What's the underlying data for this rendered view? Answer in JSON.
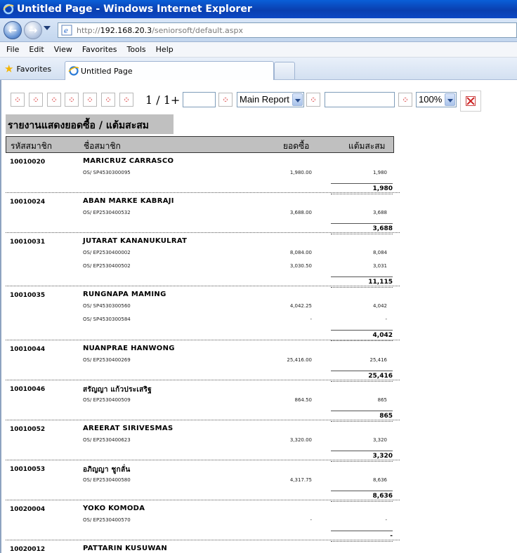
{
  "window": {
    "title": "Untitled Page - Windows Internet Explorer"
  },
  "address": {
    "scheme": "http://",
    "host": "192.168.20.3",
    "path": "/seniorsoft/default.aspx"
  },
  "menu": [
    "File",
    "Edit",
    "View",
    "Favorites",
    "Tools",
    "Help"
  ],
  "favorites_label": "Favorites",
  "tab": {
    "title": "Untitled Page"
  },
  "report_toolbar": {
    "page_indicator": "1 / 1+",
    "report_select": "Main Report",
    "zoom_select": "100%"
  },
  "report": {
    "title": "รายงานแสดงยอดซื้อ / แต้มสะสม",
    "columns": [
      "รหัสสมาชิก",
      "ชื่อสมาชิก",
      "ยอดซื้อ",
      "แต้มสะสม"
    ],
    "groups": [
      {
        "member_id": "10010020",
        "name": "MARICRUZ  CARRASCO",
        "lines": [
          {
            "doc": "OS/ SP4530300095",
            "amount": "1,980.00",
            "points": "1,980"
          }
        ],
        "total": "1,980"
      },
      {
        "member_id": "10010024",
        "name": "ABAN MARKE  KABRAJI",
        "lines": [
          {
            "doc": "OS/ EP2530400532",
            "amount": "3,688.00",
            "points": "3,688"
          }
        ],
        "total": "3,688"
      },
      {
        "member_id": "10010031",
        "name": "JUTARAT  KANANUKULRAT",
        "lines": [
          {
            "doc": "OS/ EP2530400002",
            "amount": "8,084.00",
            "points": "8,084"
          },
          {
            "doc": "OS/ EP2530400502",
            "amount": "3,030.50",
            "points": "3,031"
          }
        ],
        "total": "11,115"
      },
      {
        "member_id": "10010035",
        "name": "RUNGNAPA  MAMING",
        "lines": [
          {
            "doc": "OS/ SP4530300560",
            "amount": "4,042.25",
            "points": "4,042"
          },
          {
            "doc": "OS/ SP4530300584",
            "amount": "-",
            "points": "-"
          }
        ],
        "total": "4,042"
      },
      {
        "member_id": "10010044",
        "name": "NUANPRAE  HANWONG",
        "lines": [
          {
            "doc": "OS/ EP2530400269",
            "amount": "25,416.00",
            "points": "25,416"
          }
        ],
        "total": "25,416"
      },
      {
        "member_id": "10010046",
        "name": "สรัญญา  แก้วประเสริฐ",
        "lines": [
          {
            "doc": "OS/ EP2530400509",
            "amount": "864.50",
            "points": "865"
          }
        ],
        "total": "865"
      },
      {
        "member_id": "10010052",
        "name": "AREERAT  SIRIVESMAS",
        "lines": [
          {
            "doc": "OS/ EP2530400623",
            "amount": "3,320.00",
            "points": "3,320"
          }
        ],
        "total": "3,320"
      },
      {
        "member_id": "10010053",
        "name": "อภิญญา  ชูกลั่น",
        "lines": [
          {
            "doc": "OS/ EP2530400580",
            "amount": "4,317.75",
            "points": "8,636"
          }
        ],
        "total": "8,636"
      },
      {
        "member_id": "10020004",
        "name": "YOKO  KOMODA",
        "lines": [
          {
            "doc": "OS/ EP2530400570",
            "amount": "-",
            "points": "-"
          }
        ],
        "total": "-"
      },
      {
        "member_id": "10020012",
        "name": "PATTARIN  KUSUWAN",
        "lines": [],
        "total": ""
      }
    ]
  }
}
